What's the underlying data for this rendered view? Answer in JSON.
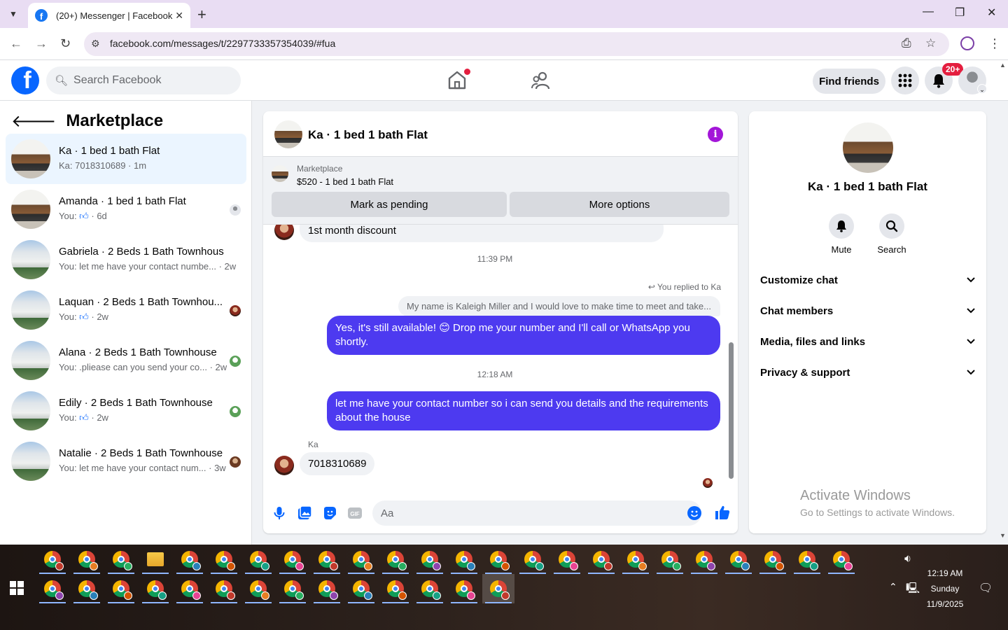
{
  "browser": {
    "tab_title": "(20+) Messenger | Facebook",
    "url": "facebook.com/messages/t/2297733357354039/#fua"
  },
  "fb_header": {
    "search_placeholder": "Search Facebook",
    "find_friends": "Find friends",
    "notif_badge": "20+"
  },
  "sidebar": {
    "title": "Marketplace",
    "conversations": [
      {
        "name": "Ka · 1 bed 1 bath Flat",
        "snippet": "Ka: 7018310689 · 1m",
        "active": true
      },
      {
        "name": "Amanda · 1 bed 1 bath Flat",
        "snippet_prefix": "You: ",
        "snippet_suffix": " · 6d"
      },
      {
        "name": "Gabriela · 2 Beds 1 Bath Townhouse",
        "snippet": "You: let me have your contact numbe... · 2w"
      },
      {
        "name": "Laquan · 2 Beds 1 Bath Townhou...",
        "snippet_prefix": "You: ",
        "snippet_suffix": " · 2w"
      },
      {
        "name": "Alana · 2 Beds 1 Bath Townhouse",
        "snippet": "You: .pliease can you send your co... · 2w"
      },
      {
        "name": "Edily · 2 Beds 1 Bath Townhouse",
        "snippet_prefix": "You: ",
        "snippet_suffix": " · 2w"
      },
      {
        "name": "Natalie · 2 Beds 1 Bath Townhouse",
        "snippet": "You: let me have your contact num... · 3w"
      }
    ]
  },
  "chat": {
    "title": "Ka · 1 bed 1 bath Flat",
    "marketplace_label": "Marketplace",
    "listing": "$520 - 1 bed 1 bath Flat",
    "mark_pending": "Mark as pending",
    "more_options": "More options",
    "messages": {
      "partial_incoming": "1st month discount",
      "time1": "11:39 PM",
      "replied_label": "You replied to Ka",
      "replied_quote": "My name is Kaleigh Miller and I would love to make time to meet and take...",
      "out1": "Yes, it's still available! 😊 Drop me your number and I'll call or WhatsApp you shortly.",
      "time2": "12:18 AM",
      "out2": "let me have your contact number so i can send you details and the requirements about the house",
      "sender": "Ka",
      "in1": "7018310689"
    },
    "composer_placeholder": "Aa"
  },
  "info_panel": {
    "name": "Ka · 1 bed 1 bath Flat",
    "mute": "Mute",
    "search": "Search",
    "sections": [
      "Customize chat",
      "Chat members",
      "Media, files and links",
      "Privacy & support"
    ]
  },
  "watermark": {
    "line1": "Activate Windows",
    "line2": "Go to Settings to activate Windows."
  },
  "taskbar": {
    "time": "12:19 AM",
    "day": "Sunday",
    "date": "11/9/2025"
  },
  "colors": {
    "fb_blue": "#0866ff",
    "outgoing_bubble": "#4d3af0",
    "notif_red": "#e41e3f",
    "info_purple": "#a316d8"
  }
}
